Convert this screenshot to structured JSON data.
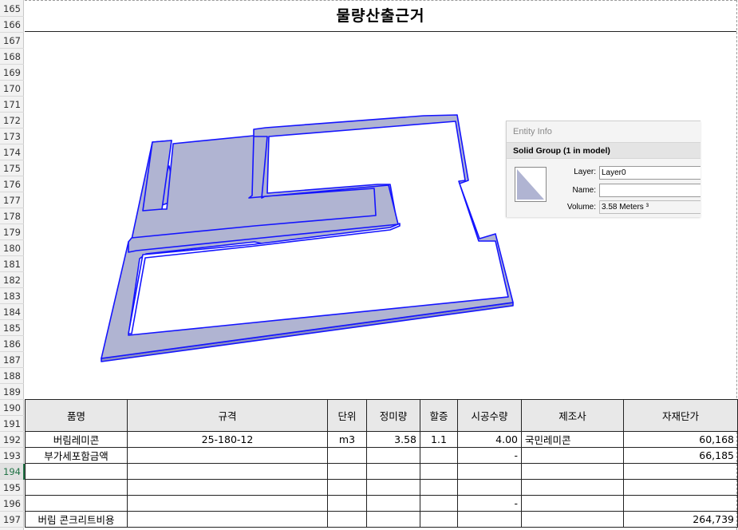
{
  "row_numbers": [
    "165",
    "166",
    "167",
    "168",
    "169",
    "170",
    "171",
    "172",
    "173",
    "174",
    "175",
    "176",
    "177",
    "178",
    "179",
    "180",
    "181",
    "182",
    "183",
    "184",
    "185",
    "186",
    "187",
    "188",
    "189",
    "190",
    "191",
    "192",
    "193",
    "194",
    "195",
    "196",
    "197"
  ],
  "selected_row": "194",
  "title": "물량산출근거",
  "entity_info": {
    "panel_title": "Entity Info",
    "selection": "Solid Group (1 in model)",
    "layer_label": "Layer:",
    "layer_value": "Layer0",
    "name_label": "Name:",
    "name_value": "",
    "volume_label": "Volume:",
    "volume_value": "3.58 Meters ³"
  },
  "table": {
    "headers": {
      "item": "품명",
      "spec": "규격",
      "unit": "단위",
      "net_qty": "정미량",
      "surcharge": "할증",
      "work_qty": "시공수량",
      "maker": "제조사",
      "unit_price": "자재단가"
    },
    "row192": {
      "item": "버림레미콘",
      "spec": "25-180-12",
      "unit": "m3",
      "net_qty": "3.58",
      "surcharge": "1.1",
      "work_qty": "4.00",
      "maker": "국민레미콘",
      "unit_price": "60,168"
    },
    "row193": {
      "item": "부가세포함금액",
      "work_qty": "-",
      "unit_price": "66,185"
    },
    "row196": {
      "work_qty": "-"
    },
    "row197": {
      "item": "버림 콘크리트비용",
      "unit_price": "264,739"
    }
  },
  "colors": {
    "wall_fill": "#b0b4d2",
    "wall_edge": "#1414ff",
    "header_fill": "#e8e8e8",
    "selected_row": "#217346"
  }
}
